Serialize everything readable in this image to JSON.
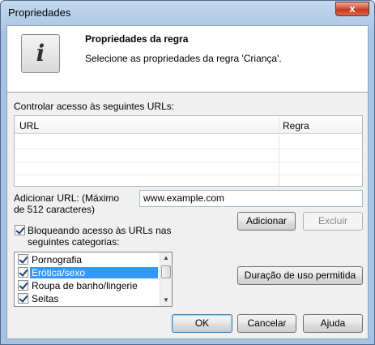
{
  "window": {
    "title": "Propriedades",
    "close_glyph": "x"
  },
  "header": {
    "icon": "info-icon",
    "title": "Propriedades da regra",
    "subtitle": "Selecione as propriedades da regra  'Criança'."
  },
  "urls": {
    "label": "Controlar acesso às seguintes URLs:",
    "columns": [
      "URL",
      "Regra"
    ]
  },
  "add_url": {
    "label_line1": "Adicionar URL: (Máximo",
    "label_line2": "de 512 caracteres)",
    "value": "www.example.com",
    "add_button": "Adicionar",
    "delete_button": "Excluir"
  },
  "categories": {
    "checkbox_label_line1": "Bloqueando acesso às URLs nas",
    "checkbox_label_line2": "seguintes categorias:",
    "checked": true,
    "items": [
      {
        "label": "Pornografia",
        "checked": true,
        "selected": false
      },
      {
        "label": "Erótica/sexo",
        "checked": true,
        "selected": true
      },
      {
        "label": "Roupa de banho/lingerie",
        "checked": true,
        "selected": false
      },
      {
        "label": "Seitas",
        "checked": true,
        "selected": false
      }
    ],
    "duration_button": "Duração de uso permitida"
  },
  "footer": {
    "ok": "OK",
    "cancel": "Cancelar",
    "help": "Ajuda"
  }
}
